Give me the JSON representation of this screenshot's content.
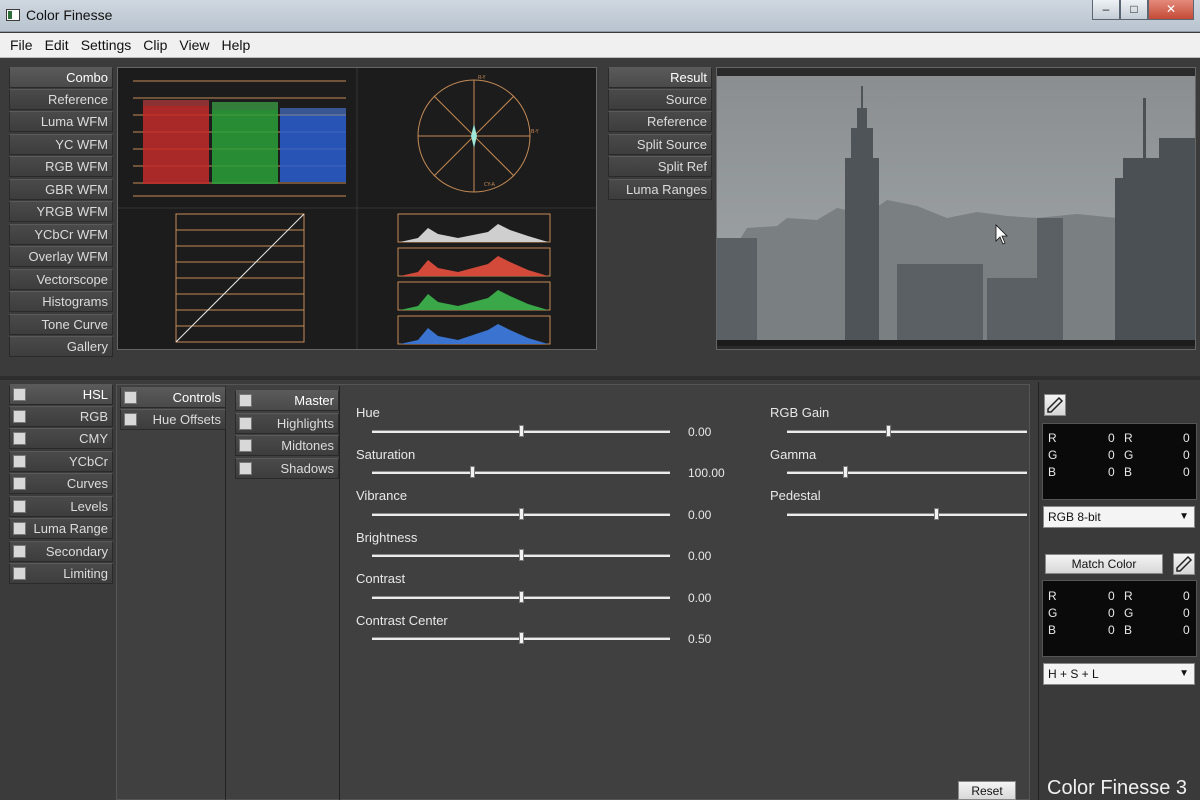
{
  "window": {
    "title": "Color Finesse",
    "buttons": [
      "–",
      "□",
      "✕"
    ]
  },
  "menu": [
    "File",
    "Edit",
    "Settings",
    "Clip",
    "View",
    "Help"
  ],
  "scope_tabs": [
    "Combo",
    "Reference",
    "Luma WFM",
    "YC WFM",
    "RGB WFM",
    "GBR WFM",
    "YRGB WFM",
    "YCbCr WFM",
    "Overlay WFM",
    "Vectorscope",
    "Histograms",
    "Tone Curve",
    "Gallery"
  ],
  "view_tabs": [
    "Result",
    "Source",
    "Reference",
    "Split Source",
    "Split Ref",
    "Luma Ranges"
  ],
  "correction_tabs": [
    "HSL",
    "RGB",
    "CMY",
    "YCbCr",
    "Curves",
    "Levels",
    "Luma Range",
    "Secondary",
    "Limiting"
  ],
  "mode_tabs": [
    "Controls",
    "Hue Offsets"
  ],
  "range_tabs": [
    "Master",
    "Highlights",
    "Midtones",
    "Shadows"
  ],
  "sliders_left": [
    {
      "label": "Hue",
      "value": "0.00",
      "pos": 0.5
    },
    {
      "label": "Saturation",
      "value": "100.00",
      "pos": 0.335
    },
    {
      "label": "Vibrance",
      "value": "0.00",
      "pos": 0.5
    },
    {
      "label": "Brightness",
      "value": "0.00",
      "pos": 0.5
    },
    {
      "label": "Contrast",
      "value": "0.00",
      "pos": 0.5
    },
    {
      "label": "Contrast Center",
      "value": "0.50",
      "pos": 0.5
    }
  ],
  "sliders_right": [
    {
      "label": "RGB Gain",
      "pos": 0.42
    },
    {
      "label": "Gamma",
      "pos": 0.24
    },
    {
      "label": "Pedestal",
      "pos": 0.62
    }
  ],
  "readout1": [
    {
      "a": "R",
      "av": "0",
      "b": "R",
      "bv": "0"
    },
    {
      "a": "G",
      "av": "0",
      "b": "G",
      "bv": "0"
    },
    {
      "a": "B",
      "av": "0",
      "b": "B",
      "bv": "0"
    }
  ],
  "readout2": [
    {
      "a": "R",
      "av": "0",
      "b": "R",
      "bv": "0"
    },
    {
      "a": "G",
      "av": "0",
      "b": "G",
      "bv": "0"
    },
    {
      "a": "B",
      "av": "0",
      "b": "B",
      "bv": "0"
    }
  ],
  "format_select": "RGB 8-bit",
  "match_color_label": "Match Color",
  "match_mode_select": "H + S + L",
  "reset_label": "Reset",
  "brand": "Color Finesse 3",
  "vectorscope_labels": [
    "R-Y",
    "B-Y",
    "CY-A"
  ],
  "icons": [
    "eyedropper-icon",
    "chevron-down-icon",
    "cursor-icon"
  ]
}
